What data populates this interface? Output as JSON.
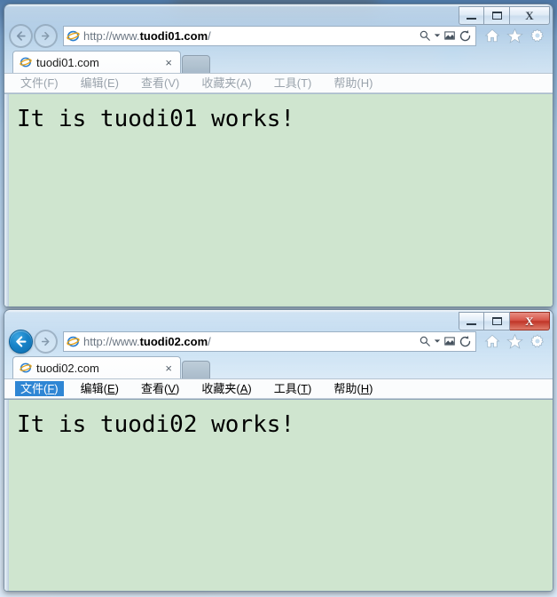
{
  "desktop": {
    "background_color": "#a8c8e6"
  },
  "windows": [
    {
      "id": "window-1",
      "active": false,
      "nav": {
        "back_label": "Back",
        "forward_label": "Forward",
        "back_icon": "arrow-left-icon",
        "forward_icon": "arrow-right-icon",
        "back_enabled": false,
        "forward_enabled": false
      },
      "address": {
        "favicon": "internet-explorer-icon",
        "url_prefix": "http://www.",
        "url_domain": "tuodi01.com",
        "url_suffix": "/",
        "url_full": "http://www.tuodi01.com/",
        "placeholder": "",
        "search_icon": "search-icon",
        "search_dropdown_icon": "chevron-down-icon",
        "compat_icon": "compatibility-view-icon",
        "refresh_icon": "refresh-icon"
      },
      "toolbar": {
        "home_icon": "home-icon",
        "favorites_icon": "star-icon",
        "settings_icon": "gear-icon",
        "home_label": "Home",
        "favorites_label": "Favorites",
        "settings_label": "Tools"
      },
      "tab": {
        "favicon": "internet-explorer-icon",
        "title": "tuodi01.com",
        "close_label": "×",
        "new_tab_label": ""
      },
      "menu": [
        {
          "label": "文件",
          "accel": "F",
          "selected": false
        },
        {
          "label": "编辑",
          "accel": "E",
          "selected": false
        },
        {
          "label": "查看",
          "accel": "V",
          "selected": false
        },
        {
          "label": "收藏夹",
          "accel": "A",
          "selected": false
        },
        {
          "label": "工具",
          "accel": "T",
          "selected": false
        },
        {
          "label": "帮助",
          "accel": "H",
          "selected": false
        }
      ],
      "titlebuttons": {
        "minimize_label": "Minimize",
        "maximize_label": "Maximize",
        "close_label": "X"
      },
      "page": {
        "background_color": "#cfe5cf",
        "text": "It is tuodi01 works!"
      }
    },
    {
      "id": "window-2",
      "active": true,
      "nav": {
        "back_label": "Back",
        "forward_label": "Forward",
        "back_icon": "arrow-left-icon",
        "forward_icon": "arrow-right-icon",
        "back_enabled": true,
        "forward_enabled": false
      },
      "address": {
        "favicon": "internet-explorer-icon",
        "url_prefix": "http://www.",
        "url_domain": "tuodi02.com",
        "url_suffix": "/",
        "url_full": "http://www.tuodi02.com/",
        "placeholder": "",
        "search_icon": "search-icon",
        "search_dropdown_icon": "chevron-down-icon",
        "compat_icon": "compatibility-view-icon",
        "refresh_icon": "refresh-icon"
      },
      "toolbar": {
        "home_icon": "home-icon",
        "favorites_icon": "star-icon",
        "settings_icon": "gear-icon",
        "home_label": "Home",
        "favorites_label": "Favorites",
        "settings_label": "Tools"
      },
      "tab": {
        "favicon": "internet-explorer-icon",
        "title": "tuodi02.com",
        "close_label": "×",
        "new_tab_label": ""
      },
      "menu": [
        {
          "label": "文件",
          "accel": "F",
          "selected": true
        },
        {
          "label": "编辑",
          "accel": "E",
          "selected": false
        },
        {
          "label": "查看",
          "accel": "V",
          "selected": false
        },
        {
          "label": "收藏夹",
          "accel": "A",
          "selected": false
        },
        {
          "label": "工具",
          "accel": "T",
          "selected": false
        },
        {
          "label": "帮助",
          "accel": "H",
          "selected": false
        }
      ],
      "titlebuttons": {
        "minimize_label": "Minimize",
        "maximize_label": "Maximize",
        "close_label": "X"
      },
      "page": {
        "background_color": "#cfe5cf",
        "text": "It is tuodi02 works!"
      }
    }
  ]
}
